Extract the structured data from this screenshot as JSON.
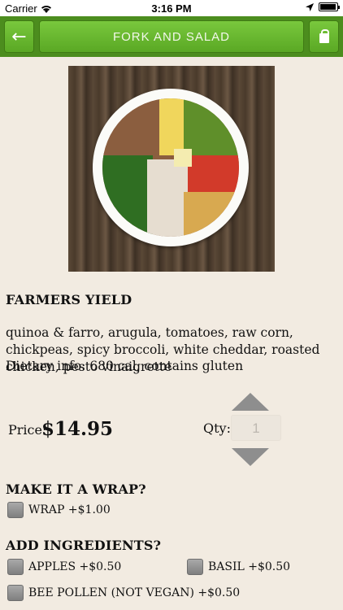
{
  "status_bar": {
    "carrier": "Carrier",
    "time": "3:16 PM",
    "battery_level": 0.95
  },
  "nav": {
    "brand": "FORK AND SALAD",
    "back_icon": "arrow-left-icon",
    "cart_icon": "shopping-bag-icon"
  },
  "product": {
    "name": "FARMERS YIELD",
    "description": "quinoa & farro, arugula, tomatoes, raw corn, chickpeas, spicy broccoli, white cheddar, roasted chicken, pesto vinaigrette",
    "dietary": "Dietary info: 680 cal, contains gluten",
    "price_label": "Price:",
    "price": "$14.95",
    "qty_label": "Qty:",
    "qty_placeholder": "1"
  },
  "wrap": {
    "heading": "MAKE IT A WRAP?",
    "option": "WRAP +$1.00"
  },
  "ingredients": {
    "heading": "ADD INGREDIENTS?",
    "items": [
      "APPLES +$0.50",
      "BASIL +$0.50",
      "BEE POLLEN (NOT VEGAN) +$0.50"
    ]
  },
  "colors": {
    "nav_green": "#4c8d1e",
    "button_green": "#6ab52f",
    "background": "#f2ebe1"
  }
}
